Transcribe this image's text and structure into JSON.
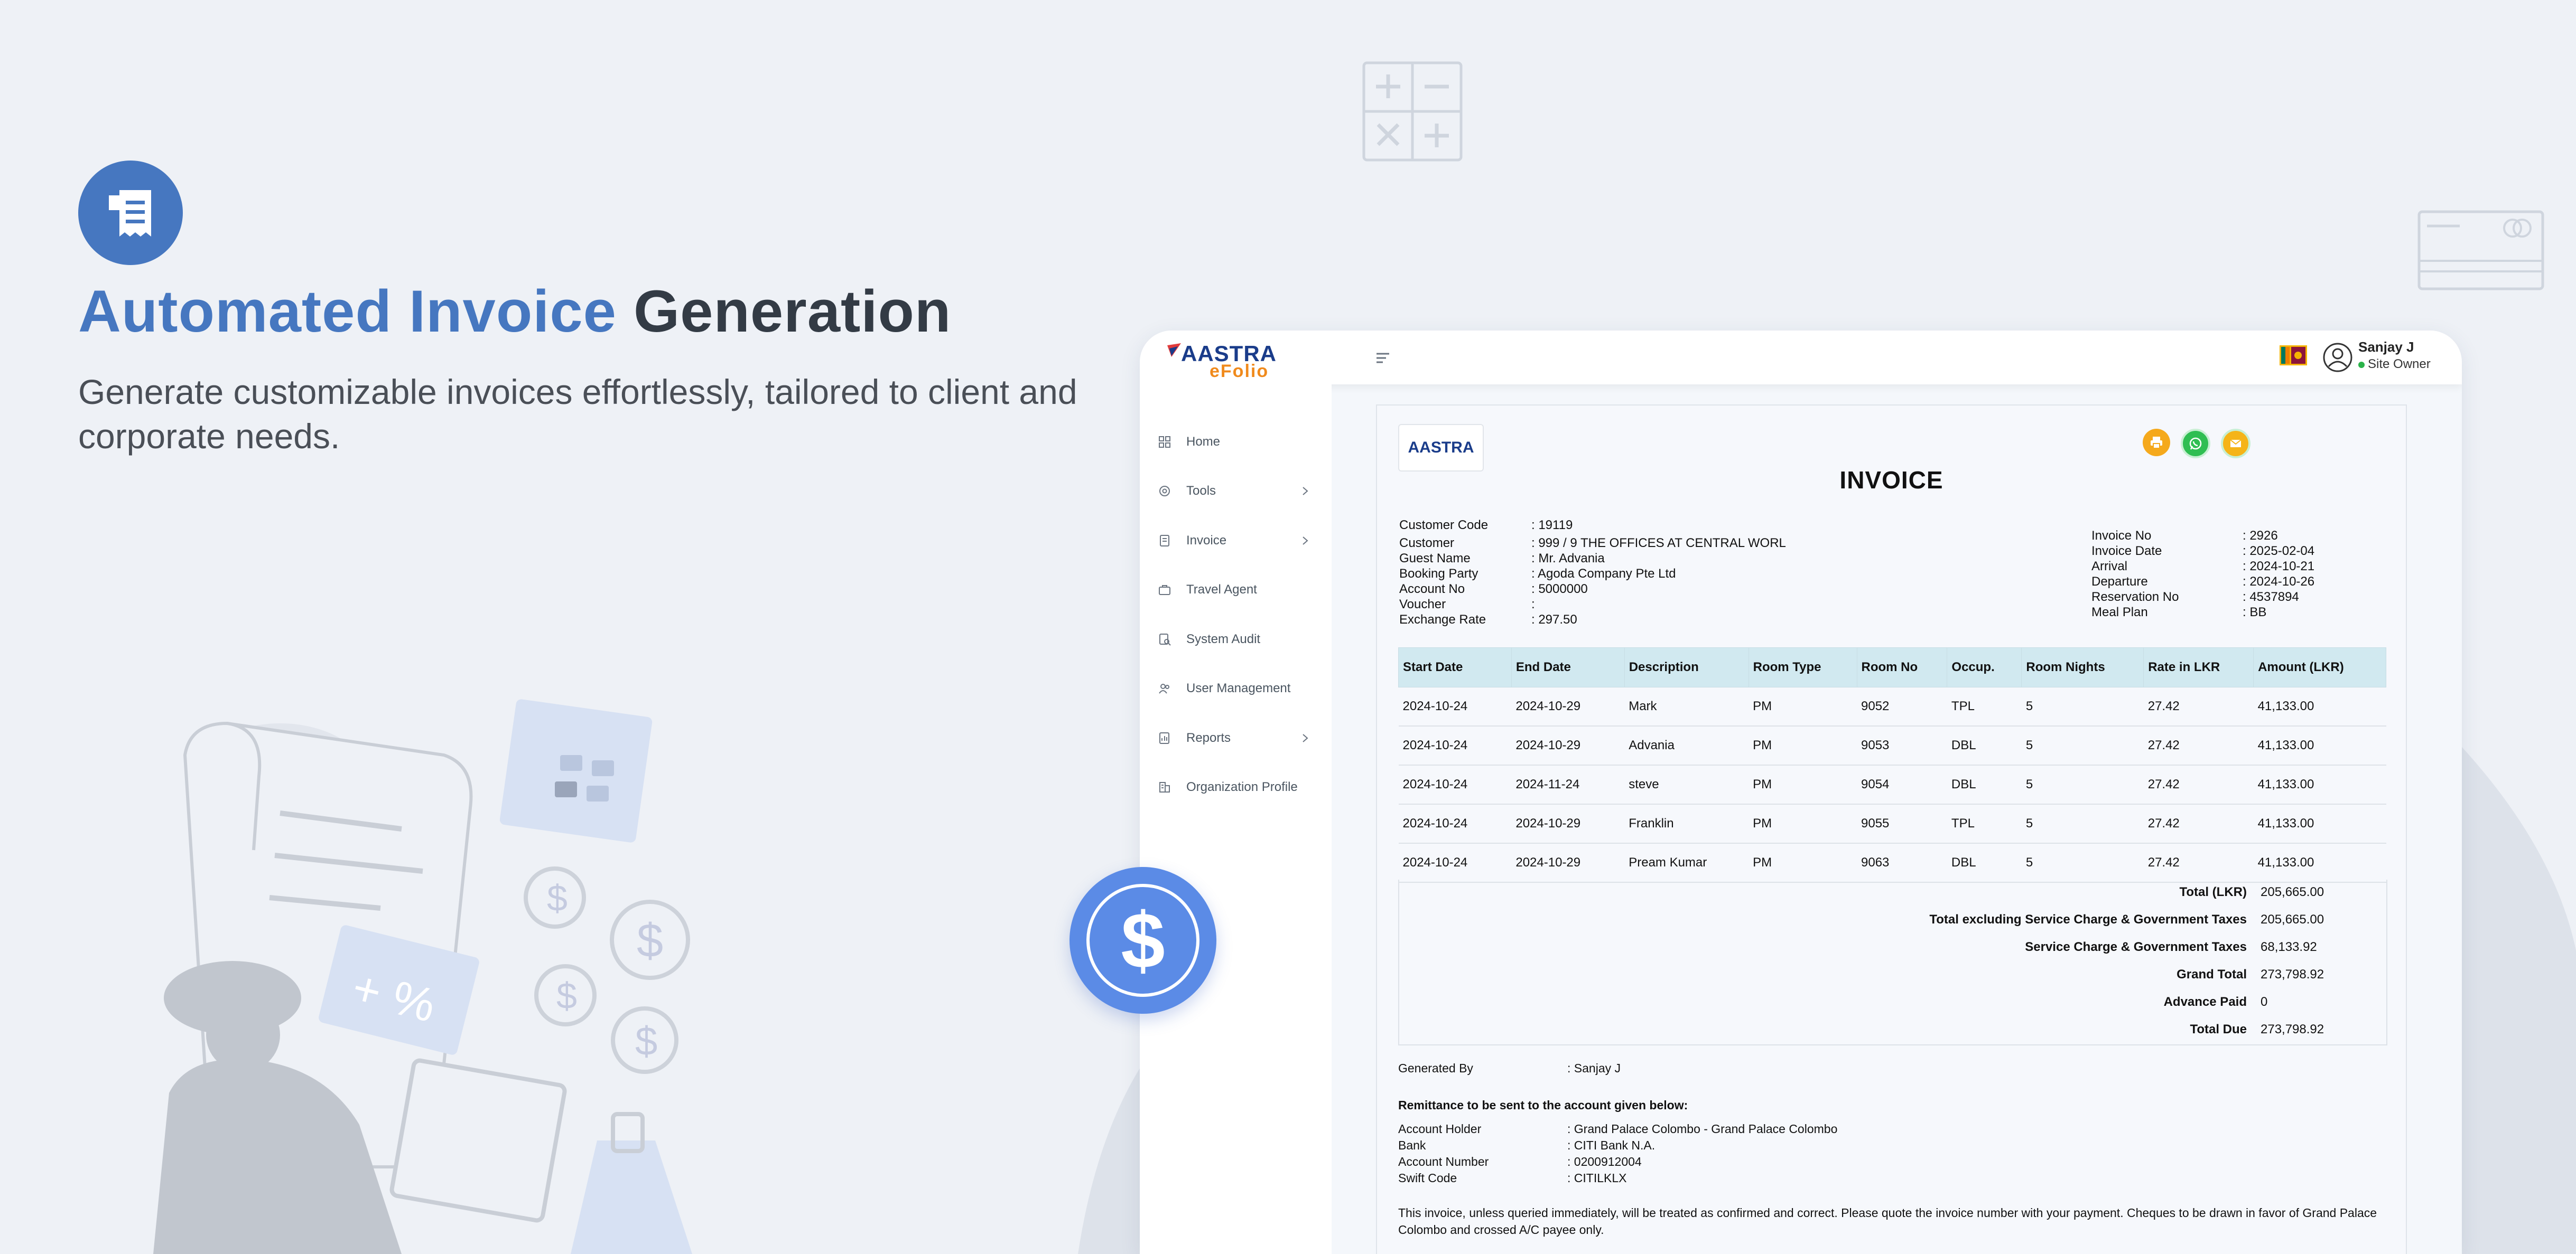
{
  "hero": {
    "title_part1": "Automated Invoice",
    "title_part2": " Generation",
    "subtitle": "Generate customizable invoices effortlessly, tailored to client and corporate needs."
  },
  "app": {
    "logo": "AASTRA",
    "logo_sub": "eFolio",
    "user": {
      "name": "Sanjay J",
      "role": "Site Owner"
    }
  },
  "sidebar": {
    "items": [
      {
        "label": "Home",
        "icon": "home-icon",
        "chevron": false
      },
      {
        "label": "Tools",
        "icon": "tools-icon",
        "chevron": true
      },
      {
        "label": "Invoice",
        "icon": "invoice-icon",
        "chevron": true
      },
      {
        "label": "Travel Agent",
        "icon": "travel-agent-icon",
        "chevron": false
      },
      {
        "label": "System Audit",
        "icon": "system-audit-icon",
        "chevron": false
      },
      {
        "label": "User Management",
        "icon": "users-icon",
        "chevron": false
      },
      {
        "label": "Reports",
        "icon": "reports-icon",
        "chevron": true
      },
      {
        "label": "Organization Profile",
        "icon": "organization-icon",
        "chevron": false
      }
    ]
  },
  "invoice": {
    "logo": "AASTRA",
    "title": "INVOICE",
    "left_fields": [
      {
        "label": "Customer Code",
        "value": ": 19119"
      },
      {
        "label": "Customer",
        "value": ": 999 / 9 THE OFFICES AT CENTRAL WORL"
      },
      {
        "label": "Guest Name",
        "value": ": Mr. Advania"
      },
      {
        "label": "Booking Party",
        "value": ": Agoda Company Pte Ltd"
      },
      {
        "label": "Account No",
        "value": ": 5000000"
      },
      {
        "label": "Voucher",
        "value": ":"
      },
      {
        "label": "Exchange Rate",
        "value": ": 297.50"
      }
    ],
    "right_fields": [
      {
        "label": "Invoice No",
        "value": ": 2926"
      },
      {
        "label": "Invoice Date",
        "value": ": 2025-02-04"
      },
      {
        "label": "Arrival",
        "value": ": 2024-10-21"
      },
      {
        "label": "Departure",
        "value": ": 2024-10-26"
      },
      {
        "label": "Reservation No",
        "value": ": 4537894"
      },
      {
        "label": "Meal Plan",
        "value": ": BB"
      }
    ],
    "columns": [
      "Start Date",
      "End Date",
      "Description",
      "Room Type",
      "Room No",
      "Occup.",
      "Room Nights",
      "Rate in LKR",
      "Amount (LKR)"
    ],
    "rows": [
      [
        "2024-10-24",
        "2024-10-29",
        "Mark",
        "PM",
        "9052",
        "TPL",
        "5",
        "27.42",
        "41,133.00"
      ],
      [
        "2024-10-24",
        "2024-10-29",
        "Advania",
        "PM",
        "9053",
        "DBL",
        "5",
        "27.42",
        "41,133.00"
      ],
      [
        "2024-10-24",
        "2024-11-24",
        "steve",
        "PM",
        "9054",
        "DBL",
        "5",
        "27.42",
        "41,133.00"
      ],
      [
        "2024-10-24",
        "2024-10-29",
        "Franklin",
        "PM",
        "9055",
        "TPL",
        "5",
        "27.42",
        "41,133.00"
      ],
      [
        "2024-10-24",
        "2024-10-29",
        "Pream Kumar",
        "PM",
        "9063",
        "DBL",
        "5",
        "27.42",
        "41,133.00"
      ]
    ],
    "totals": [
      {
        "label": "Total (LKR)",
        "value": "205,665.00"
      },
      {
        "label": "Total excluding Service Charge & Government Taxes",
        "value": "205,665.00"
      },
      {
        "label": "Service Charge & Government Taxes",
        "value": "68,133.92"
      },
      {
        "label": "Grand Total",
        "value": "273,798.92"
      },
      {
        "label": "Advance Paid",
        "value": "0"
      },
      {
        "label": "Total Due",
        "value": "273,798.92"
      }
    ],
    "generated_by_label": "Generated By",
    "generated_by_value": ": Sanjay J",
    "remittance_title": "Remittance to be sent to the account given below:",
    "remittance": [
      {
        "label": "Account Holder",
        "value": ": Grand Palace Colombo - Grand Palace Colombo"
      },
      {
        "label": "Bank",
        "value": ": CITI Bank N.A."
      },
      {
        "label": "Account Number",
        "value": ": 0200912004"
      },
      {
        "label": "Swift Code",
        "value": ": CITILKLX"
      }
    ],
    "note_line1": "This invoice, unless queried immediately, will be treated as confirmed and correct. Please quote the invoice number with your payment. Cheques to be drawn in favor of Grand Palace",
    "note_line2": "Colombo and crossed A/C payee only."
  },
  "badge": {
    "symbol": "$"
  },
  "colors": {
    "accent": "#4677c0",
    "dark_text": "#333b45",
    "table_header": "#d1e9f0",
    "badge": "#5b8be6",
    "logo_orange": "#f08a1c"
  }
}
